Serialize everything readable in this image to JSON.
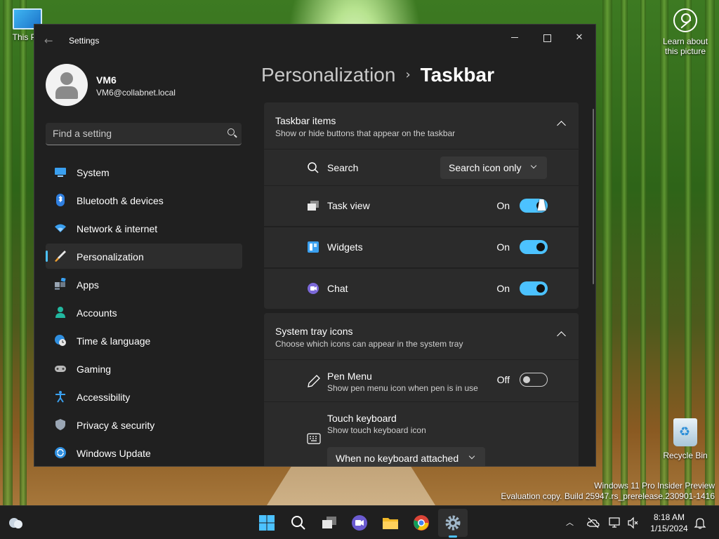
{
  "desktop": {
    "this_pc_label": "This PC",
    "learn_label": "Learn about this picture",
    "recycle_label": "Recycle Bin",
    "watermark_line1": "Windows 11 Pro Insider Preview",
    "watermark_line2": "Evaluation copy. Build 25947.rs_prerelease.230901-1416"
  },
  "window": {
    "title": "Settings",
    "back_icon": "arrow-left-icon"
  },
  "profile": {
    "name": "VM6",
    "email": "VM6@collabnet.local"
  },
  "search": {
    "placeholder": "Find a setting"
  },
  "nav": {
    "items": [
      {
        "label": "System",
        "icon": "monitor-icon"
      },
      {
        "label": "Bluetooth & devices",
        "icon": "bluetooth-icon"
      },
      {
        "label": "Network & internet",
        "icon": "wifi-icon"
      },
      {
        "label": "Personalization",
        "icon": "brush-icon",
        "active": true
      },
      {
        "label": "Apps",
        "icon": "apps-icon"
      },
      {
        "label": "Accounts",
        "icon": "person-icon"
      },
      {
        "label": "Time & language",
        "icon": "globe-clock-icon"
      },
      {
        "label": "Gaming",
        "icon": "gamepad-icon"
      },
      {
        "label": "Accessibility",
        "icon": "accessibility-icon"
      },
      {
        "label": "Privacy & security",
        "icon": "shield-icon"
      },
      {
        "label": "Windows Update",
        "icon": "update-icon"
      }
    ]
  },
  "breadcrumb": {
    "parent": "Personalization",
    "separator": "›",
    "current": "Taskbar"
  },
  "taskbar_items": {
    "title": "Taskbar items",
    "subtitle": "Show or hide buttons that appear on the taskbar",
    "search": {
      "label": "Search",
      "value": "Search icon only"
    },
    "task_view": {
      "label": "Task view",
      "state": "On"
    },
    "widgets": {
      "label": "Widgets",
      "state": "On"
    },
    "chat": {
      "label": "Chat",
      "state": "On"
    }
  },
  "tray_icons": {
    "title": "System tray icons",
    "subtitle": "Choose which icons can appear in the system tray",
    "pen_menu": {
      "label": "Pen Menu",
      "desc": "Show pen menu icon when pen is in use",
      "state": "Off"
    },
    "touch_keyboard": {
      "label": "Touch keyboard",
      "desc": "Show touch keyboard icon",
      "value": "When no keyboard attached"
    }
  },
  "taskbar": {
    "time": "8:18 AM",
    "date": "1/15/2024",
    "accent": "#4cc2ff"
  }
}
